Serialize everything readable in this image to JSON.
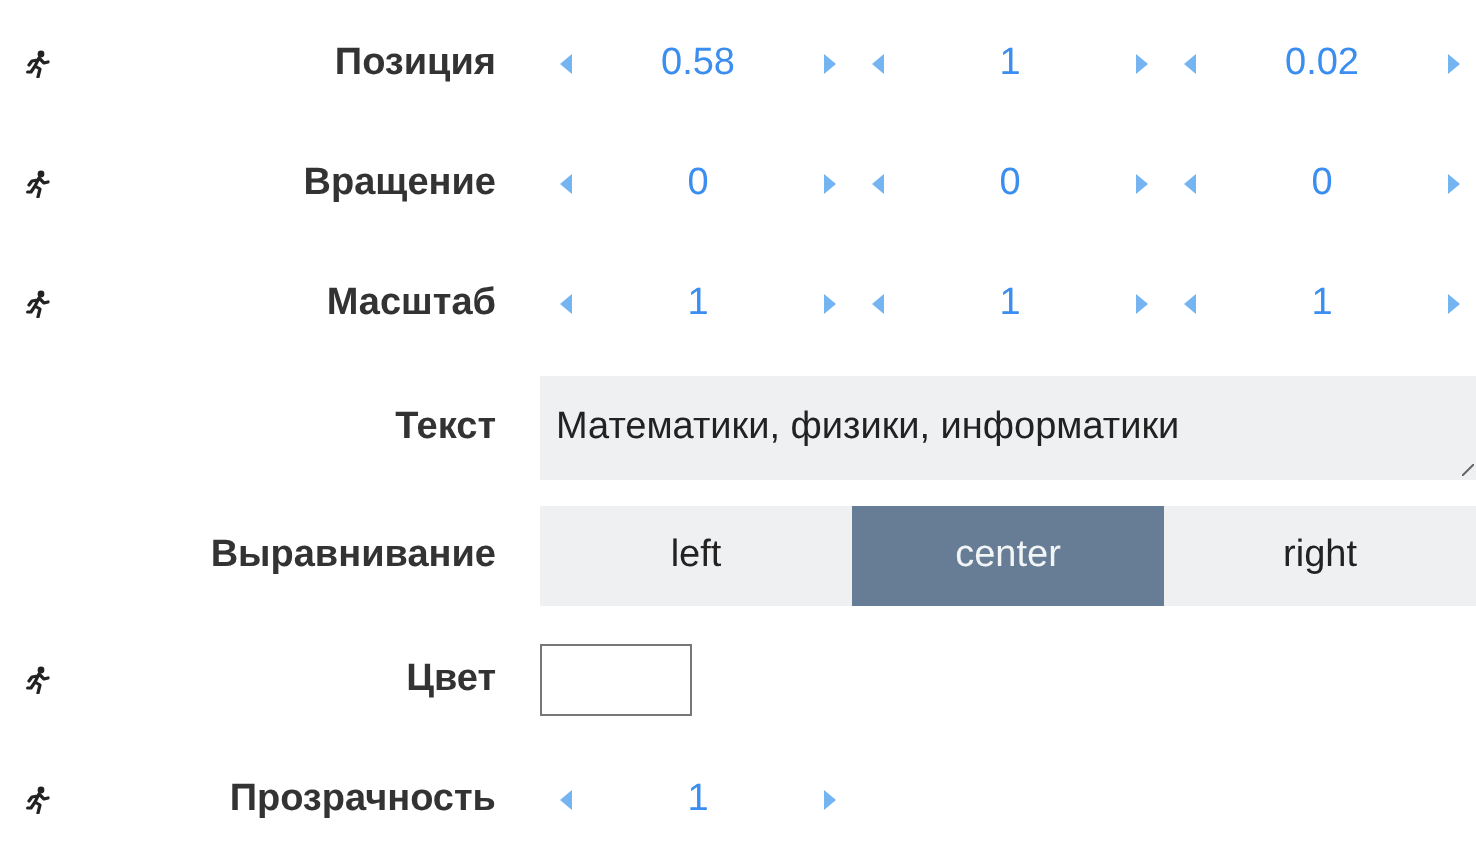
{
  "properties": [
    {
      "kind": "vector",
      "animatable": true,
      "label": "Позиция",
      "values": [
        "0.58",
        "1",
        "0.02"
      ]
    },
    {
      "kind": "vector",
      "animatable": true,
      "label": "Вращение",
      "values": [
        "0",
        "0",
        "0"
      ]
    },
    {
      "kind": "vector",
      "animatable": true,
      "label": "Масштаб",
      "values": [
        "1",
        "1",
        "1"
      ]
    },
    {
      "kind": "text",
      "animatable": false,
      "label": "Текст",
      "value": "Математики, физики, информатики"
    },
    {
      "kind": "segmented",
      "animatable": false,
      "label": "Выравнивание",
      "options": [
        {
          "label": "left",
          "selected": false
        },
        {
          "label": "center",
          "selected": true
        },
        {
          "label": "right",
          "selected": false
        }
      ]
    },
    {
      "kind": "color",
      "animatable": true,
      "label": "Цвет",
      "color": "#ffffff"
    },
    {
      "kind": "number",
      "animatable": true,
      "label": "Прозрачность",
      "values": [
        "1"
      ]
    }
  ]
}
